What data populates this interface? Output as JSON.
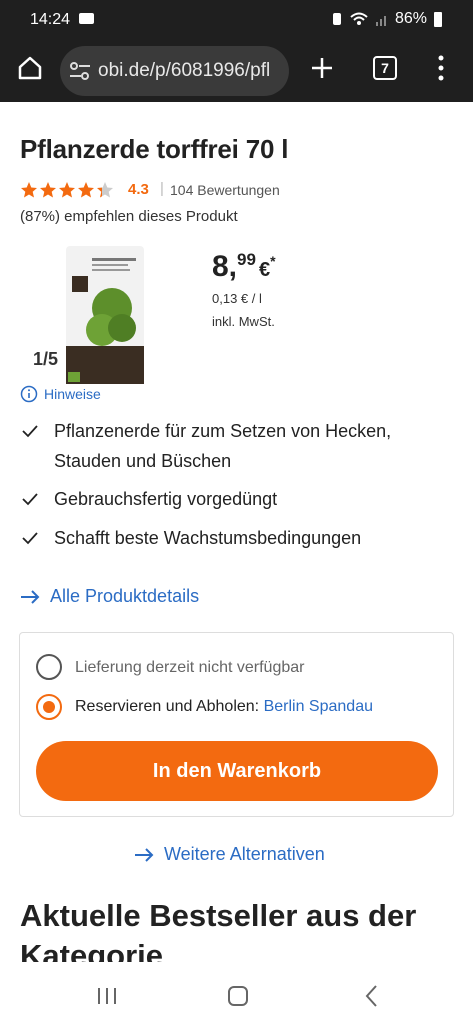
{
  "status": {
    "time": "14:24",
    "battery": "86%"
  },
  "browser": {
    "url": "obi.de/p/6081996/pfl",
    "tab_count": "7"
  },
  "product": {
    "title": "Pflanzerde torffrei 70 l",
    "rating_value": "4.3",
    "rating_stars": 4.3,
    "rating_count": "104 Bewertungen",
    "recommend": "(87%) empfehlen dieses Produkt",
    "image_counter": "1/5",
    "price_main": "8,",
    "price_cents": "99",
    "price_currency": "€",
    "price_asterisk": "*",
    "unit_price": "0,13 € / l",
    "tax_note": "inkl. MwSt.",
    "info_link": "Hinweise"
  },
  "features": [
    "Pflanzenerde für zum Setzen von Hecken, Stauden und Büschen",
    "Gebrauchsfertig vorgedüngt",
    "Schafft beste Wachstumsbedingungen"
  ],
  "details_link": "Alle Produktdetails",
  "delivery": {
    "option_delivery": "Lieferung derzeit nicht verfügbar",
    "option_pickup_label": "Reservieren und Abholen: ",
    "option_pickup_store": "Berlin Spandau",
    "cart_button": "In den Warenkorb"
  },
  "alternatives_link": "Weitere Alternativen",
  "bestseller_heading": "Aktuelle Bestseller aus der Kategorie",
  "colors": {
    "accent": "#f36a10",
    "link": "#2b6cc4",
    "browser_bg": "#1f1f1f"
  }
}
